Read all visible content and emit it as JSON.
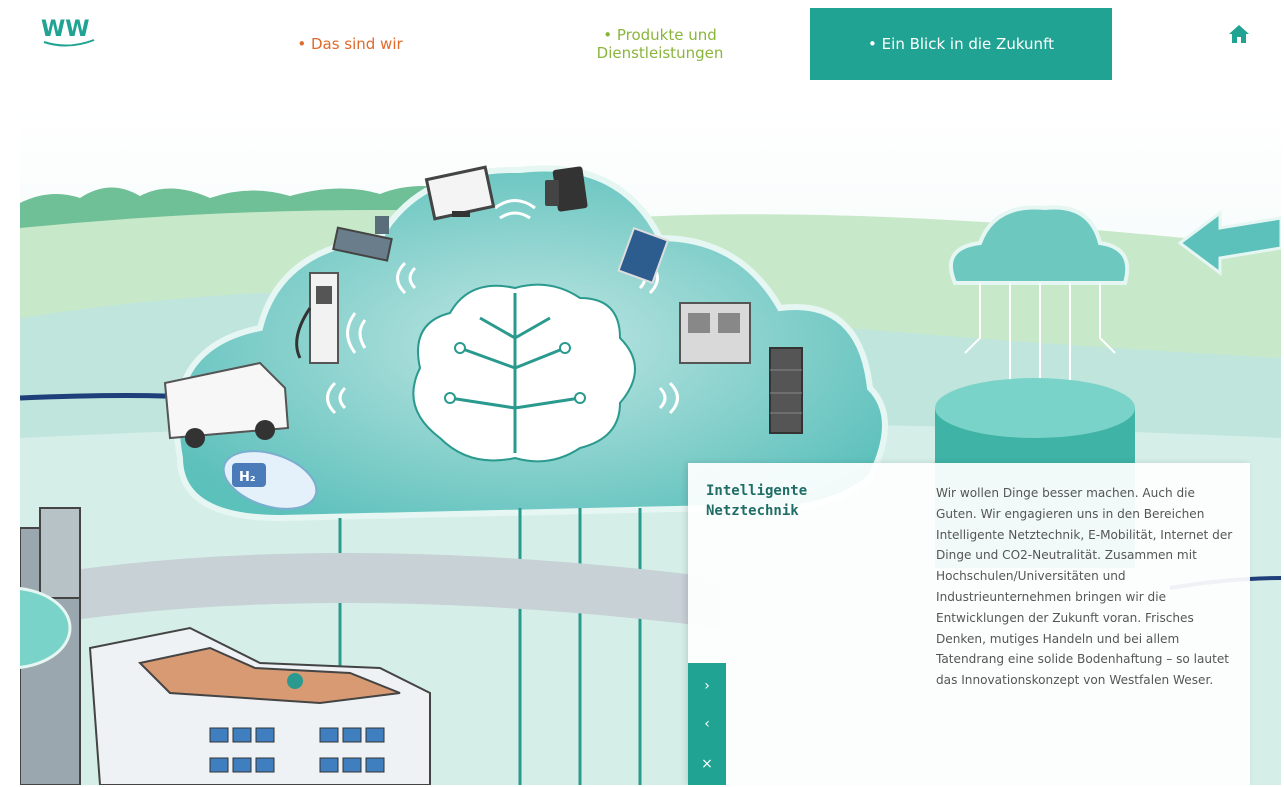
{
  "nav": {
    "items": [
      {
        "bullet": "•",
        "label": "Das sind wir",
        "color": "#e06a2c"
      },
      {
        "bullet": "•",
        "label": "Produkte und\nDienstleistungen",
        "color": "#8ab53c"
      },
      {
        "bullet": "•",
        "label": "Ein Blick in die Zukunft",
        "color": "#ffffff",
        "active": true
      }
    ],
    "home_icon": "home-icon"
  },
  "logo": {
    "icon": "ww-logo"
  },
  "illustration": {
    "h2_label": "H₂"
  },
  "panel": {
    "title": "Intelligente\nNetztechnik",
    "body": "Wir wollen Dinge besser machen. Auch die Guten. Wir engagieren uns in den Bereichen Intelligente Netztechnik, E-Mobilität, Internet der Dinge und CO2-Neutralität. Zusammen mit Hochschulen/Universitäten und Industrieunternehmen bringen wir die Entwicklungen der Zukunft voran. Frisches Denken, mutiges Handeln und bei allem Tatendrang eine solide Bodenhaftung – so lautet das Innovationskonzept von Westfalen Weser.",
    "controls": {
      "next": "›",
      "prev": "‹",
      "close": "×"
    }
  },
  "colors": {
    "accent": "#20a393",
    "orange": "#e06a2c",
    "green": "#8ab53c",
    "navy": "#1f3f7a"
  }
}
